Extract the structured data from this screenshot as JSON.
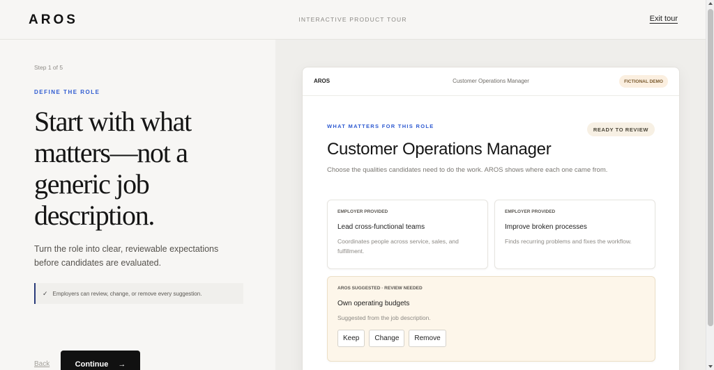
{
  "topbar": {
    "logo": "AROS",
    "tour_label": "INTERACTIVE PRODUCT TOUR",
    "exit_label": "Exit tour"
  },
  "left": {
    "step": "Step 1 of 5",
    "eyebrow": "DEFINE THE ROLE",
    "headline": "Start with what matters—not a generic job description.",
    "lede": "Turn the role into clear, reviewable expectations before candidates are evaluated.",
    "note_check": "✓",
    "note": "Employers can review, change, or remove every suggestion.",
    "back_label": "Back",
    "continue_label": "Continue",
    "continue_arrow": "→"
  },
  "preview": {
    "logo": "AROS",
    "header_title": "Customer Operations Manager",
    "demo_badge": "FICTIONAL DEMO",
    "eyebrow": "WHAT MATTERS FOR THIS ROLE",
    "status_badge": "READY TO REVIEW",
    "role_title": "Customer Operations Manager",
    "role_description": "Choose the qualities candidates need to do the work. AROS shows where each one came from.",
    "qualities": [
      {
        "tag": "EMPLOYER PROVIDED",
        "name": "Lead cross-functional teams",
        "description": "Coordinates people across service, sales, and fulfillment."
      },
      {
        "tag": "EMPLOYER PROVIDED",
        "name": "Improve broken processes",
        "description": "Finds recurring problems and fixes the workflow."
      },
      {
        "tag": "AROS SUGGESTED · REVIEW NEEDED",
        "name": "Own operating budgets",
        "description": "Suggested from the job description.",
        "actions": [
          "Keep",
          "Change",
          "Remove"
        ]
      }
    ]
  },
  "colors": {
    "accent_blue": "#2f5bd1",
    "cta_black": "#111111",
    "suggested_bg": "#fdf6ea"
  },
  "icons": {
    "check": "check-icon",
    "arrow": "arrow-right-icon"
  }
}
